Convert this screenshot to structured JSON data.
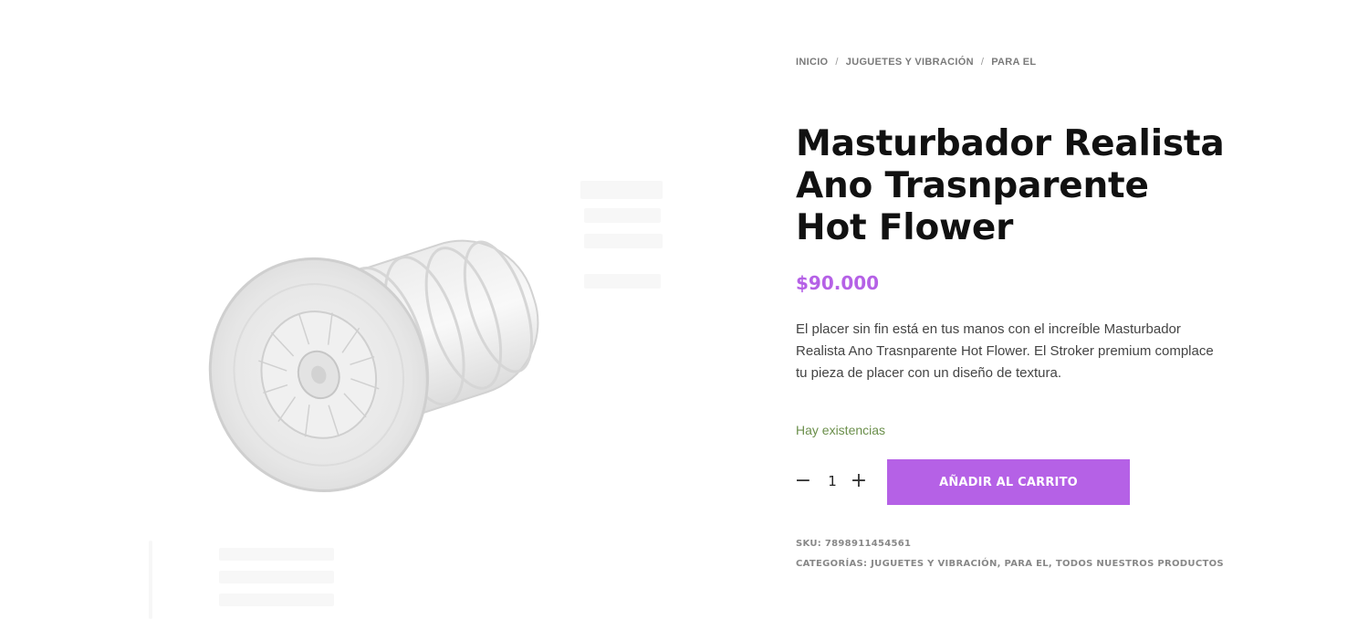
{
  "breadcrumb": {
    "items": [
      "INICIO",
      "JUGUETES Y VIBRACIÓN",
      "PARA EL"
    ],
    "separator": "/"
  },
  "product": {
    "title": "Masturbador Realista Ano Trasnparente Hot Flower",
    "price": "$90.000",
    "description": "El placer sin fin está en tus manos con el increíble Masturbador Realista Ano Trasnparente Hot Flower. El Stroker premium complace tu pieza de placer con un diseño de textura.",
    "stock": "Hay existencias",
    "quantity": "1",
    "image_alt": "transparent-stroker-product-image"
  },
  "cart": {
    "add_label": "AÑADIR AL CARRITO",
    "minus_symbol": "−",
    "plus_symbol": "+"
  },
  "meta": {
    "sku_label": "SKU:",
    "sku_value": "7898911454561",
    "categories_label": "CATEGORÍAS:",
    "categories": [
      "JUGUETES Y VIBRACIÓN",
      "PARA EL",
      "TODOS NUESTROS PRODUCTOS"
    ],
    "categories_sep": ","
  },
  "colors": {
    "accent": "#b561e6",
    "stock": "#6b8f4b"
  }
}
